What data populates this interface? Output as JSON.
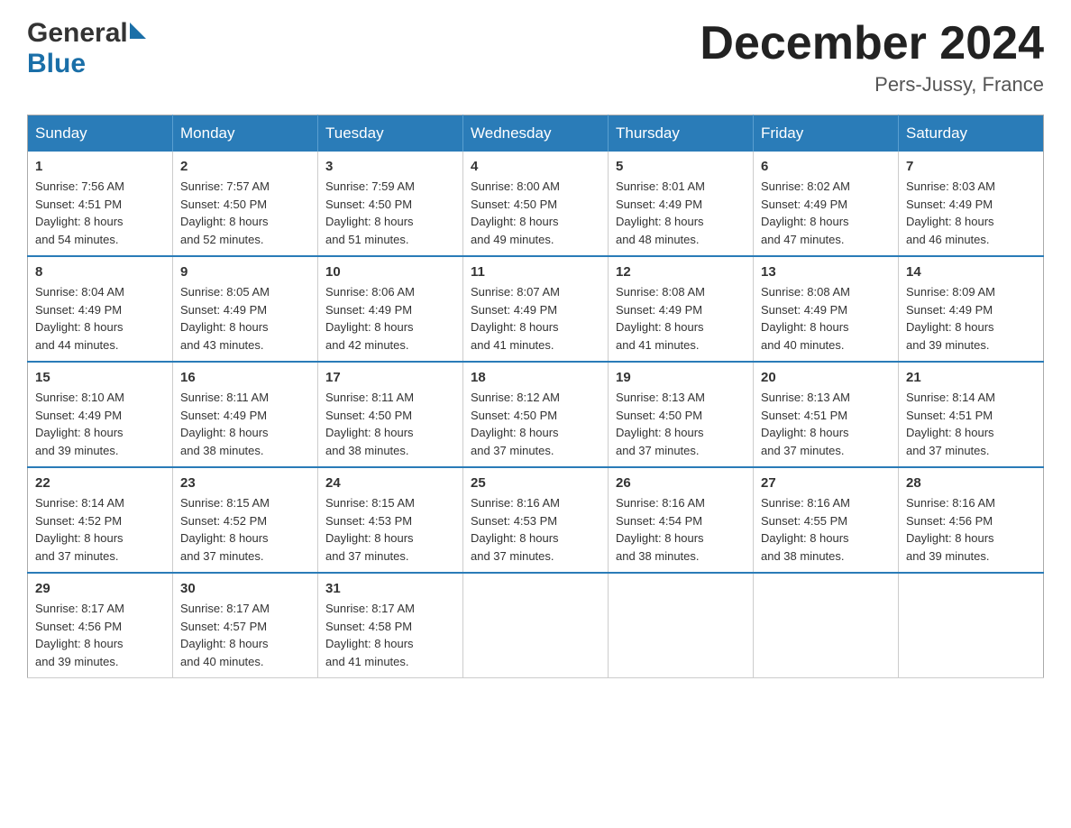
{
  "header": {
    "logo_general": "General",
    "logo_blue": "Blue",
    "month_title": "December 2024",
    "location": "Pers-Jussy, France"
  },
  "weekdays": [
    "Sunday",
    "Monday",
    "Tuesday",
    "Wednesday",
    "Thursday",
    "Friday",
    "Saturday"
  ],
  "weeks": [
    [
      {
        "day": "1",
        "sunrise": "7:56 AM",
        "sunset": "4:51 PM",
        "daylight": "8 hours and 54 minutes."
      },
      {
        "day": "2",
        "sunrise": "7:57 AM",
        "sunset": "4:50 PM",
        "daylight": "8 hours and 52 minutes."
      },
      {
        "day": "3",
        "sunrise": "7:59 AM",
        "sunset": "4:50 PM",
        "daylight": "8 hours and 51 minutes."
      },
      {
        "day": "4",
        "sunrise": "8:00 AM",
        "sunset": "4:50 PM",
        "daylight": "8 hours and 49 minutes."
      },
      {
        "day": "5",
        "sunrise": "8:01 AM",
        "sunset": "4:49 PM",
        "daylight": "8 hours and 48 minutes."
      },
      {
        "day": "6",
        "sunrise": "8:02 AM",
        "sunset": "4:49 PM",
        "daylight": "8 hours and 47 minutes."
      },
      {
        "day": "7",
        "sunrise": "8:03 AM",
        "sunset": "4:49 PM",
        "daylight": "8 hours and 46 minutes."
      }
    ],
    [
      {
        "day": "8",
        "sunrise": "8:04 AM",
        "sunset": "4:49 PM",
        "daylight": "8 hours and 44 minutes."
      },
      {
        "day": "9",
        "sunrise": "8:05 AM",
        "sunset": "4:49 PM",
        "daylight": "8 hours and 43 minutes."
      },
      {
        "day": "10",
        "sunrise": "8:06 AM",
        "sunset": "4:49 PM",
        "daylight": "8 hours and 42 minutes."
      },
      {
        "day": "11",
        "sunrise": "8:07 AM",
        "sunset": "4:49 PM",
        "daylight": "8 hours and 41 minutes."
      },
      {
        "day": "12",
        "sunrise": "8:08 AM",
        "sunset": "4:49 PM",
        "daylight": "8 hours and 41 minutes."
      },
      {
        "day": "13",
        "sunrise": "8:08 AM",
        "sunset": "4:49 PM",
        "daylight": "8 hours and 40 minutes."
      },
      {
        "day": "14",
        "sunrise": "8:09 AM",
        "sunset": "4:49 PM",
        "daylight": "8 hours and 39 minutes."
      }
    ],
    [
      {
        "day": "15",
        "sunrise": "8:10 AM",
        "sunset": "4:49 PM",
        "daylight": "8 hours and 39 minutes."
      },
      {
        "day": "16",
        "sunrise": "8:11 AM",
        "sunset": "4:49 PM",
        "daylight": "8 hours and 38 minutes."
      },
      {
        "day": "17",
        "sunrise": "8:11 AM",
        "sunset": "4:50 PM",
        "daylight": "8 hours and 38 minutes."
      },
      {
        "day": "18",
        "sunrise": "8:12 AM",
        "sunset": "4:50 PM",
        "daylight": "8 hours and 37 minutes."
      },
      {
        "day": "19",
        "sunrise": "8:13 AM",
        "sunset": "4:50 PM",
        "daylight": "8 hours and 37 minutes."
      },
      {
        "day": "20",
        "sunrise": "8:13 AM",
        "sunset": "4:51 PM",
        "daylight": "8 hours and 37 minutes."
      },
      {
        "day": "21",
        "sunrise": "8:14 AM",
        "sunset": "4:51 PM",
        "daylight": "8 hours and 37 minutes."
      }
    ],
    [
      {
        "day": "22",
        "sunrise": "8:14 AM",
        "sunset": "4:52 PM",
        "daylight": "8 hours and 37 minutes."
      },
      {
        "day": "23",
        "sunrise": "8:15 AM",
        "sunset": "4:52 PM",
        "daylight": "8 hours and 37 minutes."
      },
      {
        "day": "24",
        "sunrise": "8:15 AM",
        "sunset": "4:53 PM",
        "daylight": "8 hours and 37 minutes."
      },
      {
        "day": "25",
        "sunrise": "8:16 AM",
        "sunset": "4:53 PM",
        "daylight": "8 hours and 37 minutes."
      },
      {
        "day": "26",
        "sunrise": "8:16 AM",
        "sunset": "4:54 PM",
        "daylight": "8 hours and 38 minutes."
      },
      {
        "day": "27",
        "sunrise": "8:16 AM",
        "sunset": "4:55 PM",
        "daylight": "8 hours and 38 minutes."
      },
      {
        "day": "28",
        "sunrise": "8:16 AM",
        "sunset": "4:56 PM",
        "daylight": "8 hours and 39 minutes."
      }
    ],
    [
      {
        "day": "29",
        "sunrise": "8:17 AM",
        "sunset": "4:56 PM",
        "daylight": "8 hours and 39 minutes."
      },
      {
        "day": "30",
        "sunrise": "8:17 AM",
        "sunset": "4:57 PM",
        "daylight": "8 hours and 40 minutes."
      },
      {
        "day": "31",
        "sunrise": "8:17 AM",
        "sunset": "4:58 PM",
        "daylight": "8 hours and 41 minutes."
      },
      null,
      null,
      null,
      null
    ]
  ],
  "labels": {
    "sunrise": "Sunrise:",
    "sunset": "Sunset:",
    "daylight": "Daylight:"
  }
}
